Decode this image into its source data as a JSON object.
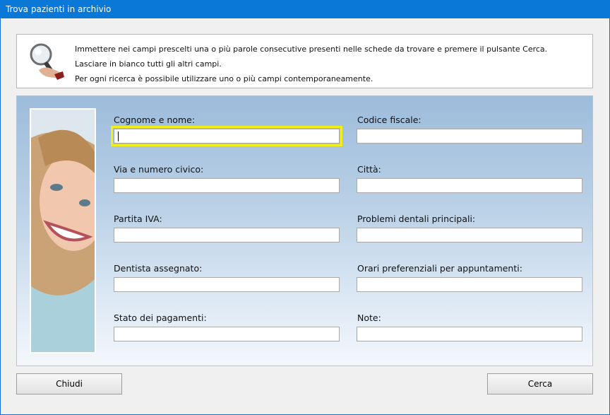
{
  "window": {
    "title": "Trova pazienti in archivio"
  },
  "info": {
    "lines": [
      "Immettere nei campi prescelti una o più parole consecutive presenti nelle schede da trovare e premere il pulsante Cerca.",
      "Lasciare in bianco tutti gli altri campi.",
      "Per ogni ricerca è possibile utilizzare uno o più campi contemporaneamente."
    ]
  },
  "form": {
    "left": [
      {
        "label": "Cognome e nome:",
        "value": ""
      },
      {
        "label": "Via e numero civico:",
        "value": ""
      },
      {
        "label": "Partita IVA:",
        "value": ""
      },
      {
        "label": "Dentista assegnato:",
        "value": ""
      },
      {
        "label": "Stato dei pagamenti:",
        "value": ""
      }
    ],
    "right": [
      {
        "label": "Codice fiscale:",
        "value": ""
      },
      {
        "label": "Città:",
        "value": ""
      },
      {
        "label": "Problemi dentali principali:",
        "value": ""
      },
      {
        "label": "Orari preferenziali per appuntamenti:",
        "value": ""
      },
      {
        "label": "Note:",
        "value": ""
      }
    ]
  },
  "buttons": {
    "close": "Chiudi",
    "search": "Cerca"
  },
  "colors": {
    "titlebar": "#0a78d7",
    "focus": "#f2ee1a",
    "panel_top": "#9dbcdb"
  }
}
